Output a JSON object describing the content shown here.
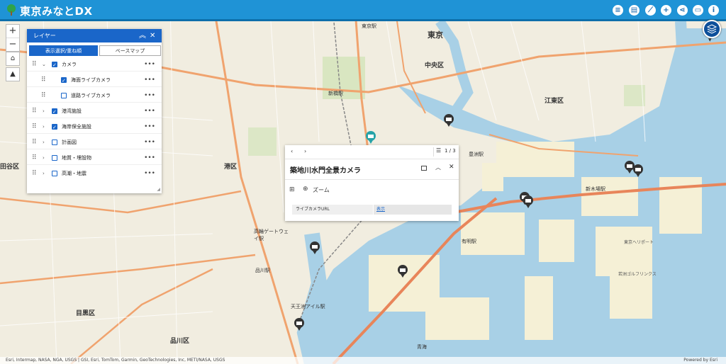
{
  "app": {
    "title": "東京みなとDX"
  },
  "header_buttons": [
    "list-icon",
    "bookmark-icon",
    "measure-icon",
    "add-icon",
    "share-icon",
    "print-icon",
    "info-icon"
  ],
  "map_controls": {
    "zoom_in": "+",
    "zoom_out": "−"
  },
  "layer_panel": {
    "title": "レイヤー",
    "tabs": [
      "表示選択/重ね順",
      "ベースマップ"
    ],
    "layers": [
      {
        "label": "カメラ",
        "checked": true,
        "expanded": true,
        "level": 0
      },
      {
        "label": "海面ライブカメラ",
        "checked": true,
        "level": 1
      },
      {
        "label": "道路ライブカメラ",
        "checked": false,
        "level": 1
      },
      {
        "label": "港湾施設",
        "checked": true,
        "level": 0
      },
      {
        "label": "海岸保全施設",
        "checked": true,
        "level": 0
      },
      {
        "label": "計画図",
        "checked": false,
        "level": 0
      },
      {
        "label": "地質・埋設物",
        "checked": false,
        "level": 0
      },
      {
        "label": "高潮・地震",
        "checked": false,
        "level": 0
      }
    ]
  },
  "popup": {
    "pager": "1 / 3",
    "title": "築地川水門全景カメラ",
    "zoom_label": "ズーム",
    "field_label": "ライブカメラURL",
    "field_value": "表示"
  },
  "map_labels": {
    "tokyo": "東京",
    "tokyo_station": "東京駅",
    "chuo": "中央区",
    "koto": "江東区",
    "minato": "港区",
    "shinbashi": "新橋駅",
    "toyosu": "豊洲駅",
    "shinkiba": "新木場駅",
    "ariake": "有明駅",
    "takanawa": "高輪ゲートウェイ駅",
    "shinagawa": "品川駅",
    "tennozu": "天王洲アイル駅",
    "meguro": "目黒区",
    "shinagawa_ku": "品川区",
    "setagaya_partial": "田谷区",
    "aomi": "青海",
    "heliport": "東京ヘリポート",
    "golf": "若洲ゴルフリンクス"
  },
  "attribution": {
    "left": "Esri, Intermap, NASA, NGA, USGS | GSI, Esri, TomTom, Garmin, GeoTechnologies, Inc, METI/NASA, USGS",
    "right": "Powered by Esri"
  }
}
